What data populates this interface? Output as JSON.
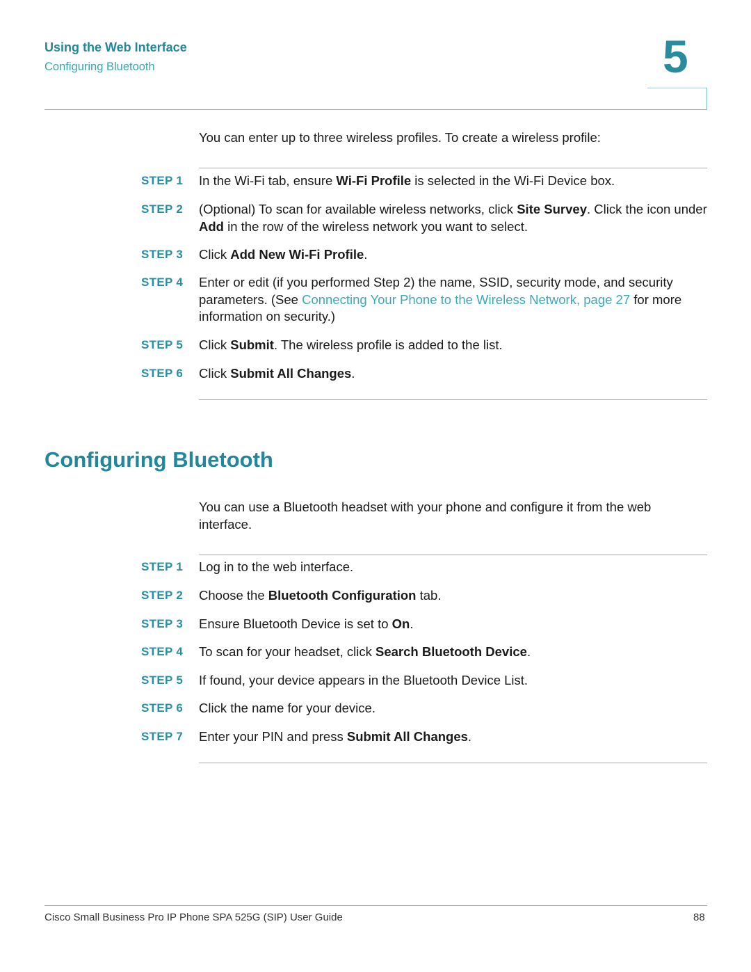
{
  "header": {
    "chapter_title": "Using the Web Interface",
    "section_subtitle": "Configuring Bluetooth",
    "chapter_number": "5"
  },
  "wifi": {
    "intro": "You can enter up to three wireless profiles. To create a wireless profile:",
    "steps": [
      {
        "label": "STEP 1",
        "parts": [
          {
            "t": "In the Wi-Fi tab, ensure "
          },
          {
            "t": "Wi-Fi Profile",
            "b": true
          },
          {
            "t": " is selected in the Wi-Fi Device box."
          }
        ]
      },
      {
        "label": "STEP 2",
        "parts": [
          {
            "t": "(Optional) To scan for available wireless networks, click "
          },
          {
            "t": "Site Survey",
            "b": true
          },
          {
            "t": ". Click the icon under "
          },
          {
            "t": "Add",
            "b": true
          },
          {
            "t": " in the row of the wireless network you want to select."
          }
        ]
      },
      {
        "label": "STEP 3",
        "parts": [
          {
            "t": "Click "
          },
          {
            "t": "Add New Wi-Fi Profile",
            "b": true
          },
          {
            "t": "."
          }
        ]
      },
      {
        "label": "STEP 4",
        "parts": [
          {
            "t": "Enter or edit (if you performed Step 2) the name, SSID, security mode, and security parameters. (See "
          },
          {
            "t": "Connecting Your Phone to the Wireless Network, page 27",
            "link": true
          },
          {
            "t": " for more information on security.)"
          }
        ]
      },
      {
        "label": "STEP 5",
        "parts": [
          {
            "t": "Click "
          },
          {
            "t": "Submit",
            "b": true
          },
          {
            "t": ". The wireless profile is added to the list."
          }
        ]
      },
      {
        "label": "STEP 6",
        "parts": [
          {
            "t": "Click "
          },
          {
            "t": "Submit All Changes",
            "b": true
          },
          {
            "t": "."
          }
        ]
      }
    ]
  },
  "bluetooth": {
    "title": "Configuring Bluetooth",
    "intro": "You can use a Bluetooth headset with your phone and configure it from the web interface.",
    "steps": [
      {
        "label": "STEP 1",
        "parts": [
          {
            "t": "Log in to the web interface."
          }
        ]
      },
      {
        "label": "STEP 2",
        "parts": [
          {
            "t": "Choose the "
          },
          {
            "t": "Bluetooth Configuration",
            "b": true
          },
          {
            "t": " tab."
          }
        ]
      },
      {
        "label": "STEP 3",
        "parts": [
          {
            "t": "Ensure Bluetooth Device is set to "
          },
          {
            "t": "On",
            "b": true
          },
          {
            "t": "."
          }
        ]
      },
      {
        "label": "STEP 4",
        "parts": [
          {
            "t": "To scan for your headset, click "
          },
          {
            "t": "Search Bluetooth Device",
            "b": true
          },
          {
            "t": "."
          }
        ]
      },
      {
        "label": "STEP 5",
        "parts": [
          {
            "t": "If found, your device appears in the Bluetooth Device List."
          }
        ]
      },
      {
        "label": "STEP 6",
        "parts": [
          {
            "t": "Click the name for your device."
          }
        ]
      },
      {
        "label": "STEP 7",
        "parts": [
          {
            "t": "Enter your PIN and press "
          },
          {
            "t": "Submit All Changes",
            "b": true
          },
          {
            "t": "."
          }
        ]
      }
    ]
  },
  "footer": {
    "guide_title": "Cisco Small Business Pro IP Phone SPA 525G (SIP) User Guide",
    "page_number": "88"
  },
  "colors": {
    "accent": "#22879b",
    "link": "#3aaabb"
  }
}
